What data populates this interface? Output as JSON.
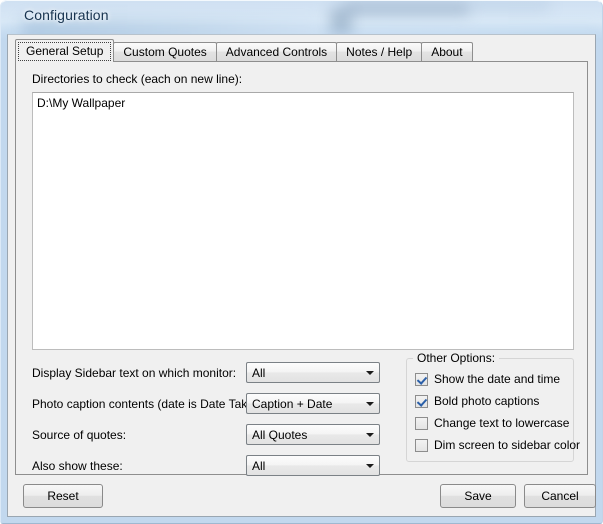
{
  "window": {
    "title": "Configuration"
  },
  "tabs": [
    {
      "label": "General Setup",
      "selected": true
    },
    {
      "label": "Custom Quotes",
      "selected": false
    },
    {
      "label": "Advanced Controls",
      "selected": false
    },
    {
      "label": "Notes / Help",
      "selected": false
    },
    {
      "label": "About",
      "selected": false
    }
  ],
  "general_setup": {
    "directories_label": "Directories to check (each on new line):",
    "directories_value": "D:\\My Wallpaper",
    "rows": [
      {
        "label": "Display Sidebar text on which monitor:",
        "value": "All"
      },
      {
        "label": "Photo caption contents (date is Date Taken):",
        "value": "Caption + Date"
      },
      {
        "label": "Source of quotes:",
        "value": "All Quotes"
      },
      {
        "label": "Also show these:",
        "value": "All"
      }
    ],
    "other_options": {
      "title": "Other Options:",
      "items": [
        {
          "label": "Show the date and time",
          "checked": true
        },
        {
          "label": "Bold photo captions",
          "checked": true
        },
        {
          "label": "Change text to lowercase",
          "checked": false
        },
        {
          "label": "Dim screen to sidebar color",
          "checked": false
        }
      ]
    }
  },
  "buttons": {
    "reset": "Reset",
    "save": "Save",
    "cancel": "Cancel"
  },
  "colors": {
    "dialog_face": "#f0f0f0",
    "glass": "#cfe0f2",
    "check_mark": "#2a5fa8",
    "text": "#000000"
  }
}
